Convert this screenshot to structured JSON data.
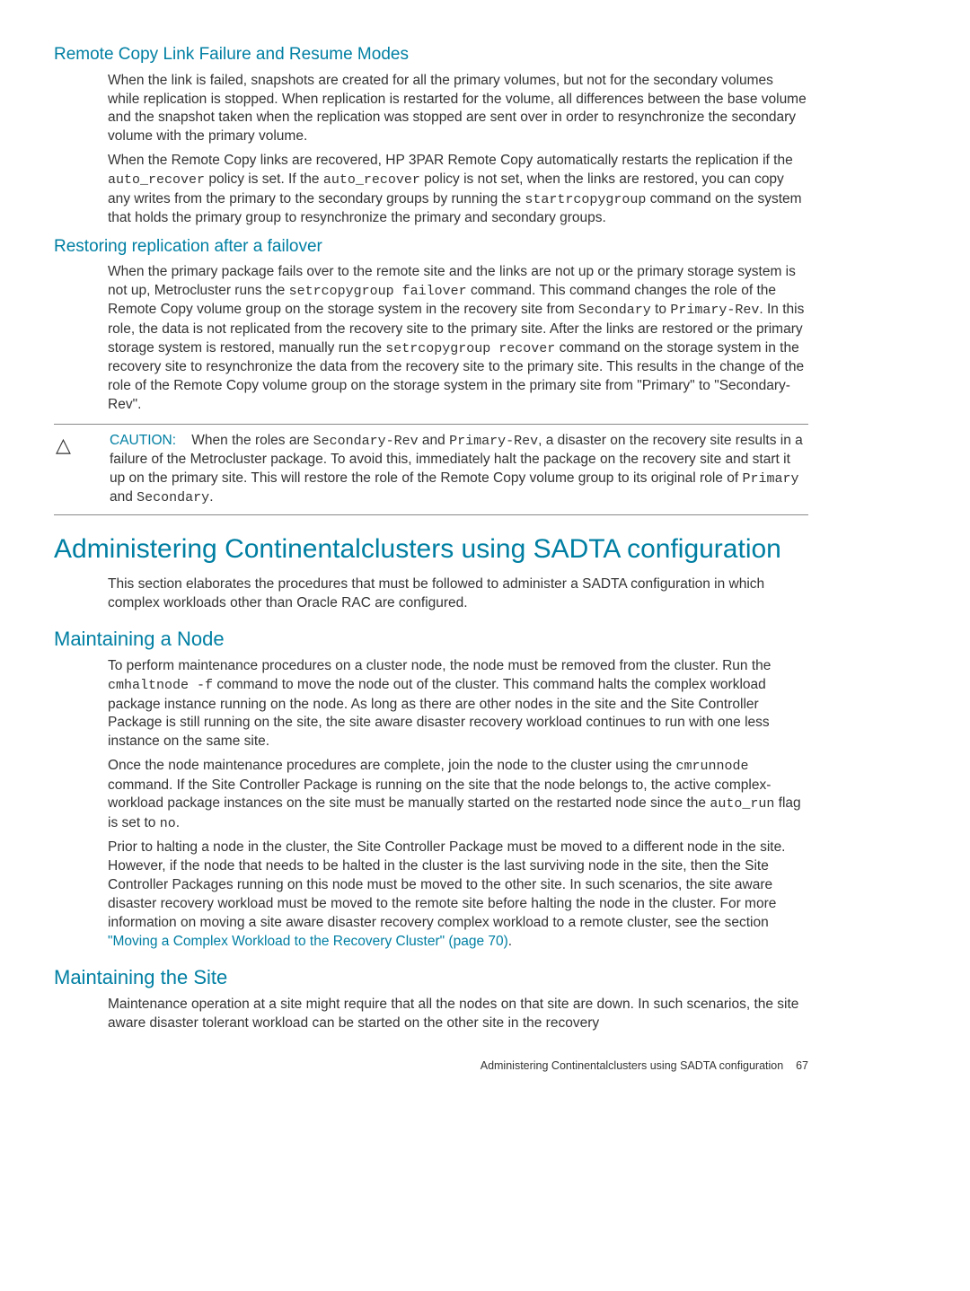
{
  "sec1": {
    "title": "Remote Copy Link Failure and Resume Modes",
    "p1": "When the link is failed, snapshots are created for all the primary volumes, but not for the secondary volumes while replication is stopped. When replication is restarted for the volume, all differences between the base volume and the snapshot taken when the replication was stopped are sent over in order to resynchronize the secondary volume with the primary volume.",
    "p2a": "When the Remote Copy links are recovered, HP 3PAR Remote Copy automatically restarts the replication if the ",
    "p2_code1": "auto_recover",
    "p2b": " policy is set. If the ",
    "p2_code2": "auto_recover",
    "p2c": " policy is not set, when the links are restored, you can copy any writes from the primary to the secondary groups by running the ",
    "p2_code3": "startrcopygroup",
    "p2d": " command on the system that holds the primary group to resynchronize the primary and secondary groups."
  },
  "sec2": {
    "title": "Restoring replication after a failover",
    "p1a": "When the primary package fails over to the remote site and the links are not up or the primary storage system is not up, Metrocluster runs the ",
    "p1_code1": "setrcopygroup failover",
    "p1b": " command. This command changes the role of the Remote Copy volume group on the storage system in the recovery site from ",
    "p1_code2": "Secondary",
    "p1c": " to ",
    "p1_code3": "Primary-Rev",
    "p1d": ". In this role, the data is not replicated from the recovery site to the primary site. After the links are restored or the primary storage system is restored, manually run the ",
    "p1_code4": "setrcopygroup recover",
    "p1e": " command on the storage system in the recovery site to resynchronize the data from the recovery site to the primary site. This results in the change of the role of the Remote Copy volume group on the storage system in the primary site from \"Primary\" to \"Secondary-Rev\"."
  },
  "caution": {
    "label": "CAUTION:",
    "a": "When the roles are ",
    "code1": "Secondary-Rev",
    "b": " and ",
    "code2": "Primary-Rev",
    "c": ", a disaster on the recovery site results in a failure of the Metrocluster package. To avoid this, immediately halt the package on the recovery site and start it up on the primary site. This will restore the role of the Remote Copy volume group to its original role of ",
    "code3": "Primary",
    "d": " and ",
    "code4": "Secondary",
    "e": "."
  },
  "sec3": {
    "title": "Administering Continentalclusters using SADTA configuration",
    "p1": "This section elaborates the procedures that must be followed to administer a SADTA configuration in which complex workloads other than Oracle RAC are configured."
  },
  "sec4": {
    "title": "Maintaining a Node",
    "p1a": "To perform maintenance procedures on a cluster node, the node must be removed from the cluster. Run the ",
    "p1_code1": "cmhaltnode -f",
    "p1b": " command to move the node out of the cluster. This command halts the complex workload package instance running on the node. As long as there are other nodes in the site and the Site Controller Package is still running on the site, the site aware disaster recovery workload continues to run with one less instance on the same site.",
    "p2a": "Once the node maintenance procedures are complete, join the node to the cluster using the ",
    "p2_code1": "cmrunnode",
    "p2b": " command. If the Site Controller Package is running on the site that the node belongs to, the active complex-workload package instances on the site must be manually started on the restarted node since the ",
    "p2_code2": "auto_run",
    "p2c": " flag is set to ",
    "p2_code3": "no",
    "p2d": ".",
    "p3a": "Prior to halting a node in the cluster, the Site Controller Package must be moved to a different node in the site. However, if the node that needs to be halted in the cluster is the last surviving node in the site, then the Site Controller Packages running on this node must be moved to the other site. In such scenarios, the site aware disaster recovery workload must be moved to the remote site before halting the node in the cluster. For more information on moving a site aware disaster recovery complex workload to a remote cluster, see the section ",
    "p3_link": "\"Moving a Complex Workload to the Recovery Cluster\" (page 70)",
    "p3b": "."
  },
  "sec5": {
    "title": "Maintaining the Site",
    "p1": "Maintenance operation at a site might require that all the nodes on that site are down. In such scenarios, the site aware disaster tolerant workload can be started on the other site in the recovery"
  },
  "footer": {
    "text": "Administering Continentalclusters using SADTA configuration",
    "page": "67"
  }
}
